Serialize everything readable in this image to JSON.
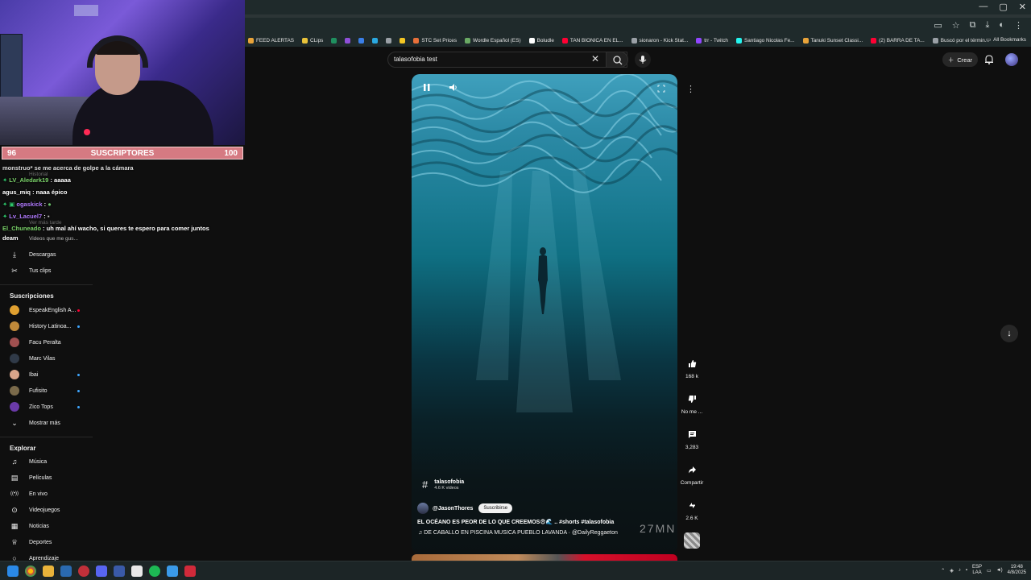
{
  "window": {
    "controls": [
      "—",
      "▢",
      "✕"
    ]
  },
  "bookmarks": {
    "items": [
      {
        "label": "FEED ALERTAS",
        "color": "#e8a33a"
      },
      {
        "label": "CLips",
        "color": "#e8c23a"
      },
      {
        "label": "",
        "color": "#1f8f5f"
      },
      {
        "label": "",
        "color": "#8f4fd8"
      },
      {
        "label": "",
        "color": "#3a7fe8"
      },
      {
        "label": "",
        "color": "#2aa8e0"
      },
      {
        "label": "",
        "color": "#9aa0a6"
      },
      {
        "label": "",
        "color": "#f3c623"
      },
      {
        "label": "STC Set Prices",
        "color": "#e8703a"
      },
      {
        "label": "Wordle Español (ES)",
        "color": "#6aaa64"
      },
      {
        "label": "Boludle",
        "color": "#ffffff"
      },
      {
        "label": "TAN BIONICA EN EL...",
        "color": "#ff0033"
      },
      {
        "label": "sionaron - Kick Stat...",
        "color": "#9aa0a6"
      },
      {
        "label": "trr - Twitch",
        "color": "#9146ff"
      },
      {
        "label": "Santiago Nicolas Fe...",
        "color": "#25f4ee"
      },
      {
        "label": "Tanuki Sunset Classi...",
        "color": "#e8a33a"
      },
      {
        "label": "(2) BARRA DE TA...",
        "color": "#ff0033"
      },
      {
        "label": "Buscó por el términ...",
        "color": "#9aa0a6"
      }
    ],
    "all_bookmarks": "All Bookmarks"
  },
  "search": {
    "query": "talasofobia test"
  },
  "masthead": {
    "create_label": "Crear"
  },
  "overlay": {
    "subs_current": "96",
    "subs_label": "SUSCRIPTORES",
    "subs_goal": "100"
  },
  "chat": [
    {
      "user": "",
      "text": "monstruo* se me acerca de golpe a la cámara"
    },
    {
      "user": "LV_Aledark19",
      "text": ": aaaaa"
    },
    {
      "user": "",
      "text": "agus_miq : naaa épico"
    },
    {
      "user": "ogaskick",
      "text": ":"
    },
    {
      "user": "Lv_Lacuel7",
      "text": ":"
    },
    {
      "user": "El_Chuneado",
      "text": ": uh mal ahí wacho, si queres te espero para comer juntos"
    },
    {
      "user": "",
      "text": "deam"
    }
  ],
  "guide": {
    "ghost": [
      "Historial",
      "Ver más tarde",
      "Videos que me gus..."
    ],
    "you_items": [
      {
        "label": "Descargas",
        "icon": "download-icon"
      },
      {
        "label": "Tus clips",
        "icon": "scissors-icon"
      }
    ],
    "subscriptions_heading": "Suscripciones",
    "subscriptions": [
      {
        "label": "EspeakEnglish A...",
        "avatar_color": "#e0a030",
        "live": true,
        "live_color": "#ff0033"
      },
      {
        "label": "History Latinoa...",
        "avatar_color": "#c08a3a",
        "live": true,
        "live_color": "#3ea6ff"
      },
      {
        "label": "Facu Peralta",
        "avatar_color": "#a05050",
        "live": false
      },
      {
        "label": "Marc Vilas",
        "avatar_color": "#303a48",
        "live": false
      },
      {
        "label": "Ibai",
        "avatar_color": "#d9a58a",
        "live": true,
        "live_color": "#3ea6ff"
      },
      {
        "label": "Fufisito",
        "avatar_color": "#7a6a4a",
        "live": true,
        "live_color": "#3ea6ff"
      },
      {
        "label": "Zico Tops",
        "avatar_color": "#6a3aa8",
        "live": true,
        "live_color": "#3ea6ff"
      }
    ],
    "show_more": "Mostrar más",
    "explore_heading": "Explorar",
    "explore": [
      {
        "label": "Música",
        "icon": "music-icon"
      },
      {
        "label": "Películas",
        "icon": "film-icon"
      },
      {
        "label": "En vivo",
        "icon": "live-icon"
      },
      {
        "label": "Videojuegos",
        "icon": "gamepad-icon"
      },
      {
        "label": "Noticias",
        "icon": "news-icon"
      },
      {
        "label": "Deportes",
        "icon": "trophy-icon"
      },
      {
        "label": "Aprendizaje",
        "icon": "lightbulb-icon"
      }
    ]
  },
  "short": {
    "hashtag": "talasofobia",
    "hashtag_count": "4.6 K videos",
    "channel": "@JasonThores",
    "subscribe_label": "Suscribirse",
    "title": "EL OCÉANO ES PEOR DE LO QUE CREEMOS😨🌊 .. #shorts #talasofobia",
    "music": "DE CABALLO EN PISCINA MUSICA PUEBLO LAVANDA · @DailyReggaeton",
    "watermark": "27MN"
  },
  "actions": {
    "likes": "168 k",
    "dislike_label": "No me ...",
    "comments": "3,283",
    "share_label": "Compartir",
    "remix_count": "2.6 K"
  },
  "taskbar": {
    "lang_top": "ESP",
    "lang_bottom": "LAA",
    "time": "19:48",
    "date": "4/8/2025"
  }
}
